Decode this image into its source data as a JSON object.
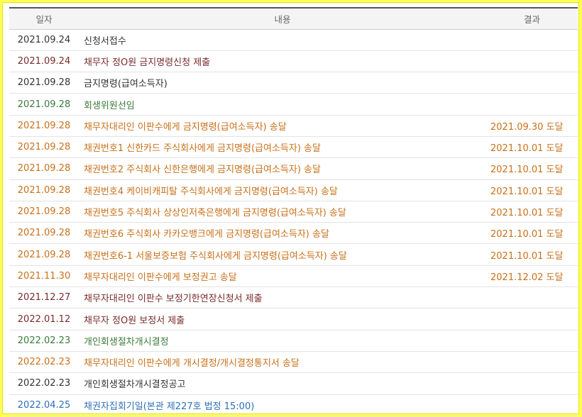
{
  "header": {
    "date": "일자",
    "content": "내용",
    "result": "결과"
  },
  "colors": {
    "dark": "#7a2b2b",
    "orange": "#c8701a",
    "green": "#3b7a3b",
    "black": "#333333",
    "blue": "#2e6fb8",
    "highlight": "#ffff66"
  },
  "rows": [
    {
      "date": "2021.09.24",
      "content": "신청서접수",
      "result": "",
      "color": "black",
      "highlight": true
    },
    {
      "date": "2021.09.24",
      "content": "채무자 정O원 금지명령신청 제출",
      "result": "",
      "color": "dark"
    },
    {
      "date": "2021.09.28",
      "content": "금지명령(급여소득자)",
      "result": "",
      "color": "black",
      "highlight": true
    },
    {
      "date": "2021.09.28",
      "content": "회생위원선임",
      "result": "",
      "color": "green"
    },
    {
      "date": "2021.09.28",
      "content": "채무자대리인 이판수에게 금지명령(급여소득자) 송달",
      "result": "2021.09.30 도달",
      "color": "orange"
    },
    {
      "date": "2021.09.28",
      "content": "채권번호1 신한카드 주식회사에게 금지명령(급여소득자) 송달",
      "result": "2021.10.01 도달",
      "color": "orange"
    },
    {
      "date": "2021.09.28",
      "content": "채권번호2 주식회사 신한은행에게 금지명령(급여소득자) 송달",
      "result": "2021.10.01 도달",
      "color": "orange"
    },
    {
      "date": "2021.09.28",
      "content": "채권번호4 케이비캐피탈 주식회사에게 금지명령(급여소득자) 송달",
      "result": "2021.10.01 도달",
      "color": "orange"
    },
    {
      "date": "2021.09.28",
      "content": "채권번호5 주식회사 상상인저축은행에게 금지명령(급여소득자) 송달",
      "result": "2021.10.01 도달",
      "color": "orange"
    },
    {
      "date": "2021.09.28",
      "content": "채권번호6 주식회사 카카오뱅크에게 금지명령(급여소득자) 송달",
      "result": "2021.10.01 도달",
      "color": "orange"
    },
    {
      "date": "2021.09.28",
      "content": "채권번호6-1 서울보증보험 주식회사에게 금지명령(급여소득자) 송달",
      "result": "2021.10.01 도달",
      "color": "orange"
    },
    {
      "date": "2021.11.30",
      "content": "채무자대리인 이판수에게 보정권고 송달",
      "result": "2021.12.02 도달",
      "color": "orange"
    },
    {
      "date": "2021.12.27",
      "content": "채무자대리인 이판수 보정기한연장신청서 제출",
      "result": "",
      "color": "dark"
    },
    {
      "date": "2022.01.12",
      "content": "채무자 정O원 보정서 제출",
      "result": "",
      "color": "dark"
    },
    {
      "date": "2022.02.23",
      "content": "개인회생절차개시결정",
      "result": "",
      "color": "green"
    },
    {
      "date": "2022.02.23",
      "content": "채무자대리인 이판수에게 개시결정/개시결정통지서 송달",
      "result": "",
      "color": "orange"
    },
    {
      "date": "2022.02.23",
      "content": "개인회생절차개시결정공고",
      "result": "",
      "color": "black"
    },
    {
      "date": "2022.04.25",
      "content": "채권자집회기일(본관 제227호 법정 15:00)",
      "result": "",
      "color": "blue"
    }
  ]
}
